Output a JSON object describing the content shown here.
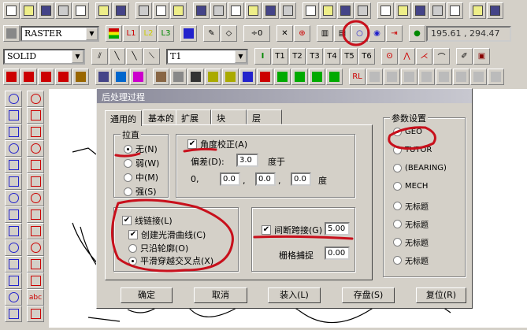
{
  "toolbar1": {
    "icons": [
      "new-icon",
      "open-icon",
      "save-icon",
      "print-preview-icon",
      "print-icon",
      "copy-icon",
      "paste-icon",
      "undo-icon",
      "redo-icon",
      "import-icon",
      "frame-icon",
      "crop-icon",
      "zoom-icon",
      "zoom-in-icon",
      "zoom-out-icon",
      "zoom-fit-icon",
      "pointer-icon",
      "select-icon",
      "vector-icon",
      "area-icon",
      "grid-icon",
      "snap-icon",
      "magnet-icon",
      "ortho-icon",
      "measure-icon",
      "help-icon",
      "context-help-icon"
    ]
  },
  "toolbar2": {
    "layer_select": "RASTER",
    "l1": "L1",
    "l2": "L2",
    "l3": "L3",
    "spin_value": "0",
    "coordinates": "195.61 , 294.47"
  },
  "toolbar3": {
    "linetype_select": "SOLID",
    "text_select": "T1",
    "t_buttons": [
      "T1",
      "T2",
      "T3",
      "T4",
      "T5",
      "T6"
    ]
  },
  "toolbar4": {
    "rl_label": "RL"
  },
  "left_tools": {
    "labels": [
      "abc"
    ]
  },
  "dialog": {
    "title": "后处理过程",
    "tabs": [
      "通用的",
      "基本的",
      "扩展",
      "块",
      "层"
    ],
    "straighten": {
      "legend": "拉直",
      "options": [
        "无(N)",
        "弱(W)",
        "中(M)",
        "强(S)"
      ],
      "selected": 0
    },
    "angle": {
      "label": "角度校正(A)",
      "checked": true,
      "deviation_label": "偏差(D):",
      "deviation": "3.0",
      "degree_to": "度于",
      "zero": "0,",
      "values": [
        "0.0",
        "0.0",
        "0.0"
      ],
      "sep": ",",
      "degree": "度"
    },
    "linejoin": {
      "label": "线链接(L)",
      "checked": true,
      "smooth_label": "创建光滑曲线(C)",
      "smooth_checked": true,
      "options": [
        "只沿轮廓(O)",
        "平滑穿越交叉点(X)"
      ],
      "selected": 1
    },
    "gap": {
      "label": "间断跨接(G)",
      "checked": true,
      "value": "5.00",
      "grid_label": "栅格捕捉",
      "grid_value": "0.00"
    },
    "params": {
      "legend": "参数设置",
      "options": [
        "GEO",
        "TUTOR",
        "(BEARING)",
        "MECH",
        "无标题",
        "无标题",
        "无标题",
        "无标题"
      ],
      "selected": 0
    },
    "buttons": {
      "ok": "确定",
      "cancel": "取消",
      "load": "装入(L)",
      "save": "存盘(S)",
      "reset": "复位(R)"
    }
  },
  "colors": {
    "annotation": "#c8101c"
  }
}
